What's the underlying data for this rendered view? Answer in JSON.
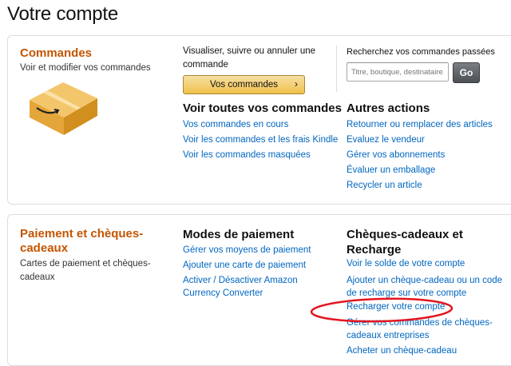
{
  "page": {
    "title": "Votre compte"
  },
  "orders": {
    "title": "Commandes",
    "subtitle": "Voir et modifier vos commandes",
    "manage_text": "Visualiser, suivre ou annuler une commande",
    "button_label": "Vos commandes",
    "search_label": "Recherchez vos commandes passées",
    "search_placeholder": "Titre, boutique, destinataire...",
    "go_label": "Go",
    "all_orders_heading": "Voir toutes vos commandes",
    "all_orders_links": [
      "Vos commandes en cours",
      "Voir les commandes et les frais Kindle",
      "Voir les commandes masquées"
    ],
    "other_actions_heading": "Autres actions",
    "other_actions_links": [
      "Retourner ou remplacer des articles",
      "Evaluez le vendeur",
      "Gérer vos abonnements",
      "Évaluer un emballage",
      "Recycler un article"
    ]
  },
  "payment": {
    "title": "Paiement et chèques-cadeaux",
    "subtitle": "Cartes de paiement et chèques-cadeaux",
    "methods_heading": "Modes de paiement",
    "methods_links": [
      "Gérer vos moyens de paiement",
      "Ajouter une carte de paiement",
      "Activer / Désactiver Amazon Currency Converter"
    ],
    "giftcards_heading": "Chèques-cadeaux et Recharge",
    "giftcards_links": [
      "Voir le solde de votre compte",
      "Ajouter un chèque-cadeau ou un code de recharge sur votre compte",
      "Recharger votre compte",
      "Gérer vos commandes de chèques-cadeaux entreprises",
      "Acheter un chèque-cadeau"
    ]
  },
  "colors": {
    "title_orange": "#c45500",
    "link_blue": "#0066c0",
    "annotation_red": "#e3151f"
  }
}
